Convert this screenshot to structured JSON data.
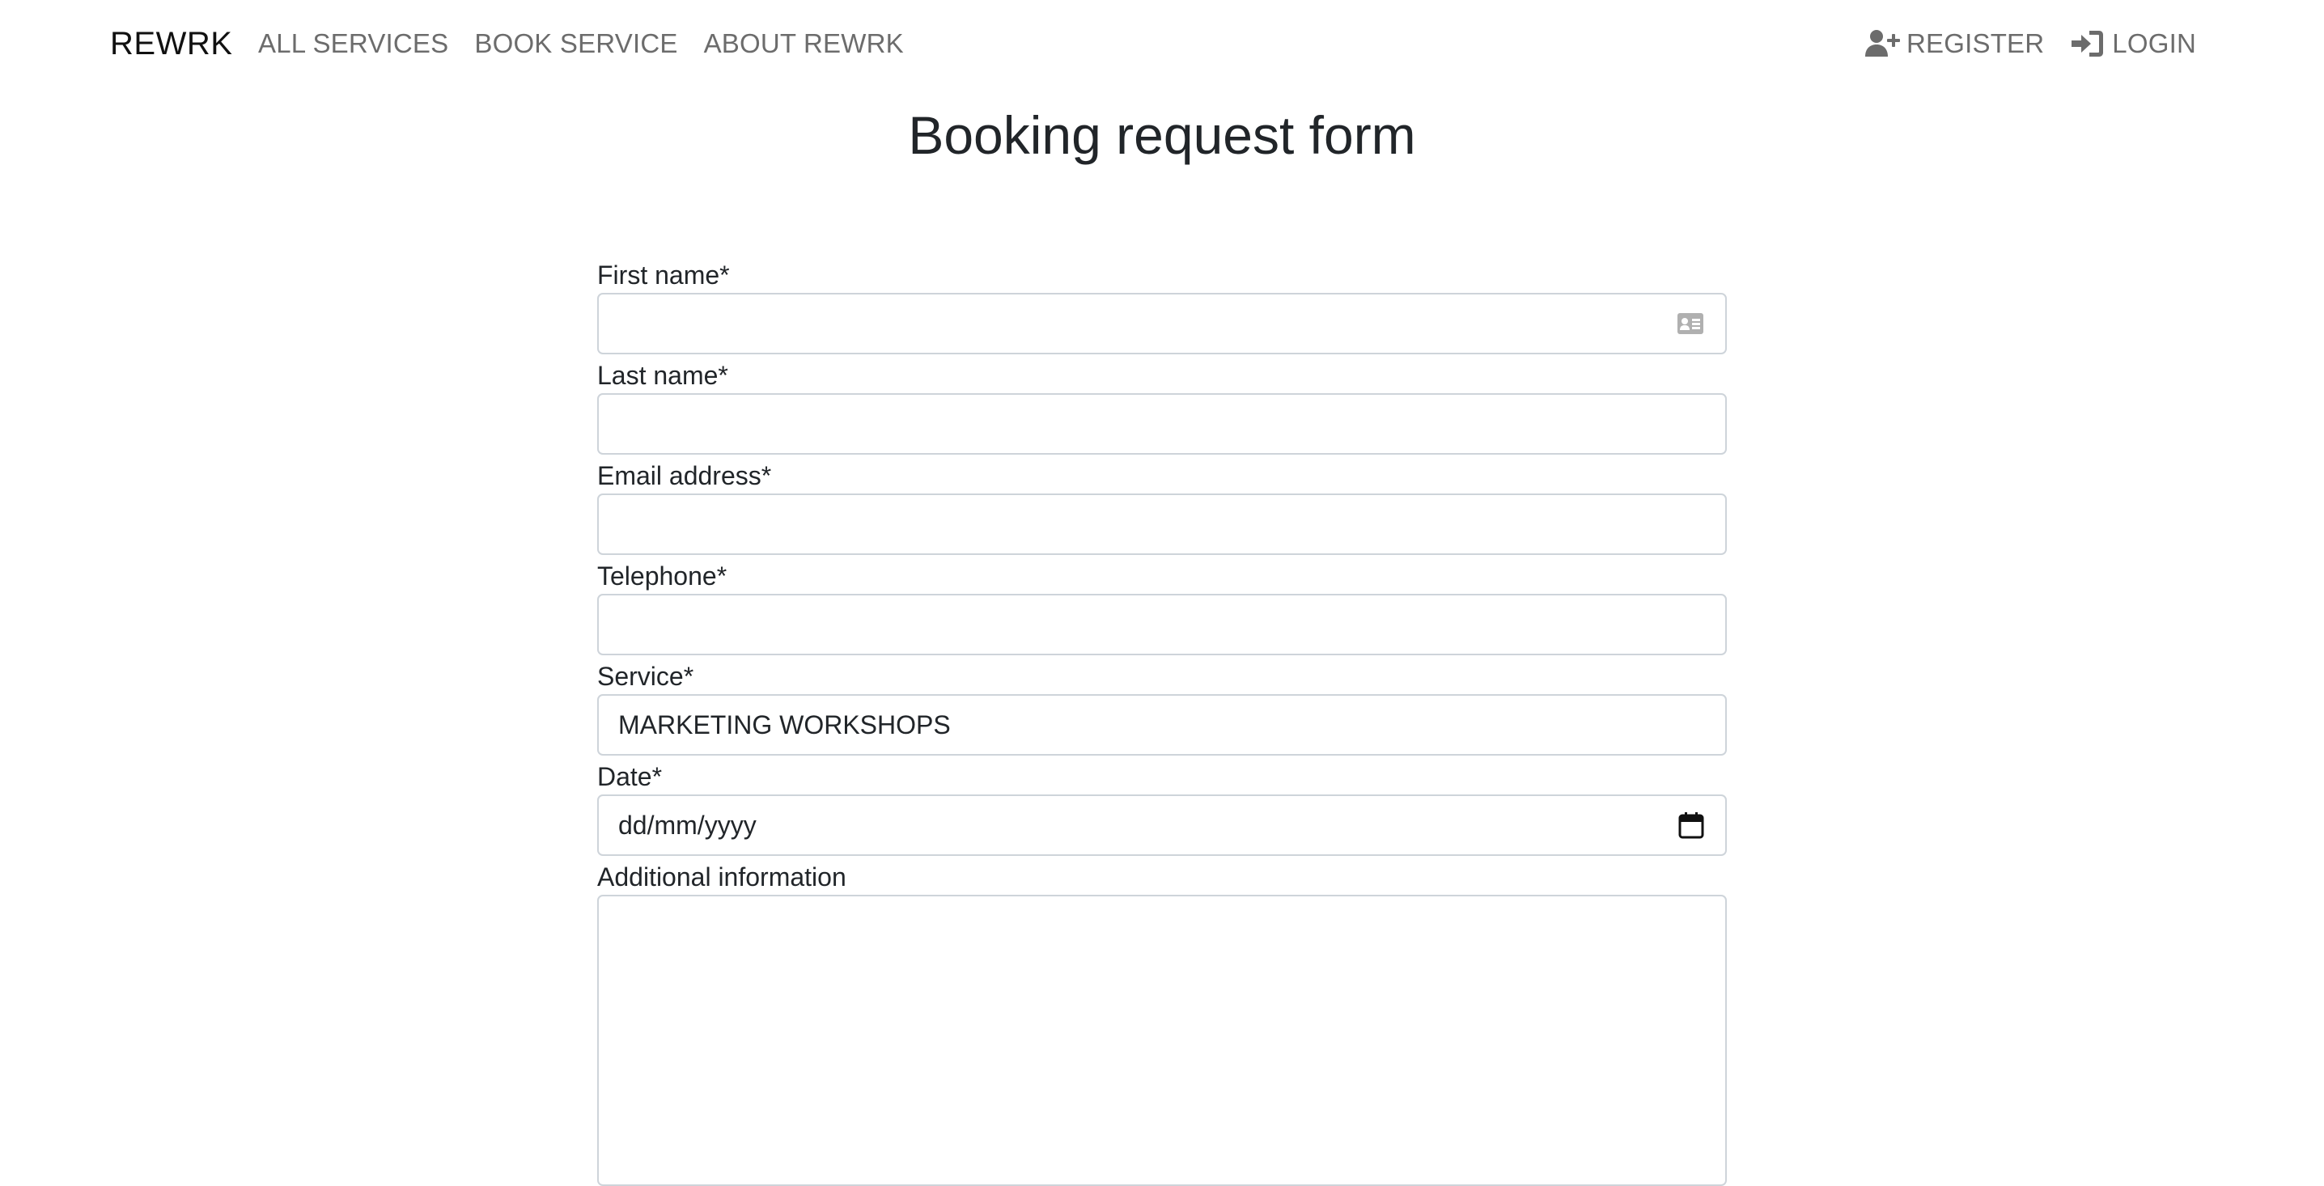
{
  "navbar": {
    "brand": "REWRK",
    "links": [
      {
        "label": "ALL SERVICES"
      },
      {
        "label": "BOOK SERVICE"
      },
      {
        "label": "ABOUT REWRK"
      }
    ],
    "register": {
      "label": "REGISTER",
      "icon": "user-plus-icon"
    },
    "login": {
      "label": "LOGIN",
      "icon": "sign-in-icon"
    }
  },
  "page": {
    "title": "Booking request form"
  },
  "form": {
    "first_name": {
      "label": "First name*",
      "value": "",
      "icon": "contact-card-icon"
    },
    "last_name": {
      "label": "Last name*",
      "value": ""
    },
    "email": {
      "label": "Email address*",
      "value": ""
    },
    "telephone": {
      "label": "Telephone*",
      "value": ""
    },
    "service": {
      "label": "Service*",
      "value": "MARKETING WORKSHOPS"
    },
    "date": {
      "label": "Date*",
      "value": "dd/mm/yyyy",
      "icon": "calendar-icon"
    },
    "additional": {
      "label": "Additional information",
      "value": ""
    }
  },
  "colors": {
    "nav_text": "#6c6c6c",
    "brand_text": "#111111",
    "input_border": "#ced4da",
    "body_text": "#212529"
  }
}
